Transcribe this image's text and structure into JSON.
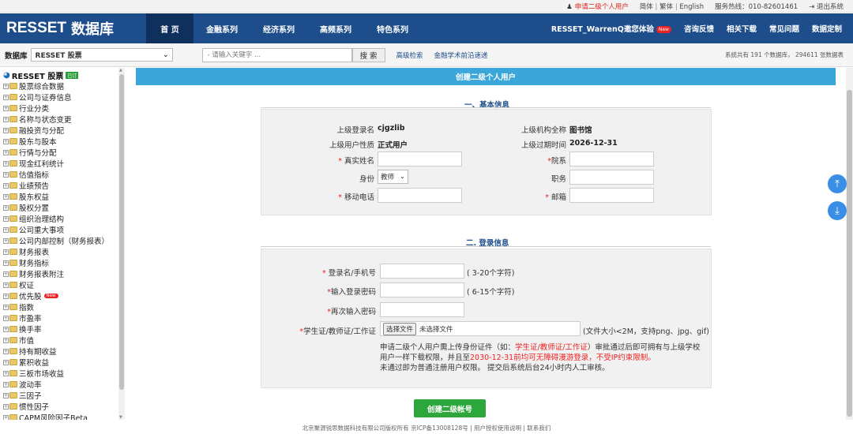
{
  "topbar": {
    "apply_label": "申请二级个人用户",
    "lang_simplified": "简体",
    "lang_traditional": "繁体",
    "lang_english": "English",
    "hotline": "服务热线：010-82601461",
    "logout": "退出系统"
  },
  "header": {
    "logo_en": "RESSET",
    "logo_cn": "数据库",
    "nav": [
      "首 页",
      "金融系列",
      "经济系列",
      "高频系列",
      "特色系列"
    ],
    "invite": "RESSET_WarrenQ邀您体验",
    "new_badge": "New",
    "links": [
      "咨询反馈",
      "相关下载",
      "常见问题",
      "数据定制"
    ]
  },
  "searchbar": {
    "db_label": "数据库",
    "db_selected": "RESSET 股票",
    "placeholder": "- 请输入关键字 ...",
    "search_button": "搜 索",
    "advanced": "高级检索",
    "frontier": "金融学术前沿速递",
    "stats": "系统共有 191 个数据库， 294611 张数据表"
  },
  "sidebar": {
    "root": "RESSET 股票",
    "root_tag": "已订",
    "items": [
      {
        "label": "股票综合数据"
      },
      {
        "label": "公司与证券信息"
      },
      {
        "label": "行业分类"
      },
      {
        "label": "名称与状态变更"
      },
      {
        "label": "融投资与分配"
      },
      {
        "label": "股东与股本"
      },
      {
        "label": "行情与分配"
      },
      {
        "label": "现金红利统计"
      },
      {
        "label": "估值指标"
      },
      {
        "label": "业绩预告"
      },
      {
        "label": "股东权益"
      },
      {
        "label": "股权分置"
      },
      {
        "label": "组织治理结构"
      },
      {
        "label": "公司重大事项"
      },
      {
        "label": "公司内部控制（财务报表）"
      },
      {
        "label": "财务报表"
      },
      {
        "label": "财务指标"
      },
      {
        "label": "财务报表附注"
      },
      {
        "label": "权证"
      },
      {
        "label": "优先股",
        "tag": "New"
      },
      {
        "label": "指数"
      },
      {
        "label": "市盈率"
      },
      {
        "label": "换手率"
      },
      {
        "label": "市值"
      },
      {
        "label": "持有期收益"
      },
      {
        "label": "累积收益"
      },
      {
        "label": "三板市场收益"
      },
      {
        "label": "波动率"
      },
      {
        "label": "三因子"
      },
      {
        "label": "惯性因子"
      },
      {
        "label": "CAPM风险因子Beta"
      }
    ]
  },
  "form": {
    "title": "创建二级个人用户",
    "section1_title": "一、基本信息",
    "parent_login_label": "上级登录名",
    "parent_login_value": "cjgzlib",
    "parent_org_label": "上级机构全称",
    "parent_org_value": "图书馆",
    "parent_type_label": "上级用户性质",
    "parent_type_value": "正式用户",
    "parent_expire_label": "上级过期时间",
    "parent_expire_value": "2026-12-31",
    "real_name_label": "真实姓名",
    "department_label": "院系",
    "identity_label": "身份",
    "identity_value": "教师",
    "position_label": "职务",
    "mobile_label": "移动电话",
    "email_label": "邮箱",
    "section2_title": "二. 登录信息",
    "login_name_label": "登录名/手机号",
    "login_name_hint": "( 3-20个字符)",
    "password_label": "输入登录密码",
    "password_hint": "( 6-15个字符)",
    "password2_label": "再次输入密码",
    "id_doc_label": "学生证/教师证/工作证",
    "file_button": "选择文件",
    "file_status": "未选择文件",
    "file_hint": "(文件大小<2M，支持png、jpg、gif)",
    "note_line1_a": "申请二级个人用户需上传身份证件（如：",
    "note_line1_red": "学生证/教师证/工作证",
    "note_line1_b": "）审批通过后即可拥有与上级学校",
    "note_line2_a": "用户一样下载权限，并且至",
    "note_line2_red": "2030-12-31前均可无障碍漫游登录，不受IP约束限制",
    "note_line2_b": "。",
    "note_line3": "未通过即为普通注册用户权限。 提交后系统后台24小时内人工审核。",
    "submit": "创建二级帐号"
  },
  "footer": {
    "text": "北京聚源锐思数据科技有限公司版权所有  京ICP备13008128号 | 用户授权使用说明 | 联系我们"
  },
  "colors": {
    "header_bg": "#1d4d8b",
    "panel_bar": "#3aa6d9",
    "submit_bg": "#2da63b",
    "required": "#e22222"
  }
}
